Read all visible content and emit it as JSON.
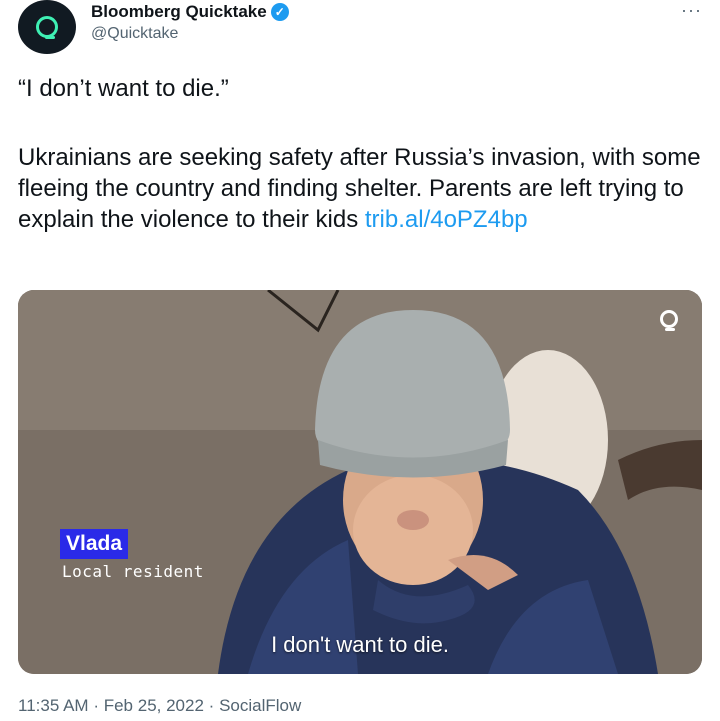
{
  "author": {
    "name": "Bloomberg Quicktake",
    "handle": "@Quicktake",
    "verified_icon": "✓",
    "avatar_icon": "quicktake-logo"
  },
  "more_label": "···",
  "tweet": {
    "quote": "“I don’t want to die.”",
    "body": "Ukrainians are seeking safety after Russia’s invasion, with some fleeing the country and finding shelter. Parents are left trying to explain the violence to their kids",
    "link": "trib.al/4oPZ4bp"
  },
  "media": {
    "name_tag": "Vlada",
    "role_tag": "Local resident",
    "subtitle": "I don't want to die."
  },
  "meta": {
    "time": "11:35 AM",
    "separator": "·",
    "date": "Feb 25, 2022",
    "source": "SocialFlow"
  },
  "colors": {
    "link": "#1d9bf0",
    "verified": "#1d9bf0",
    "brand_accent": "#3ff0b4",
    "name_tag_bg": "#2a2ae8"
  }
}
